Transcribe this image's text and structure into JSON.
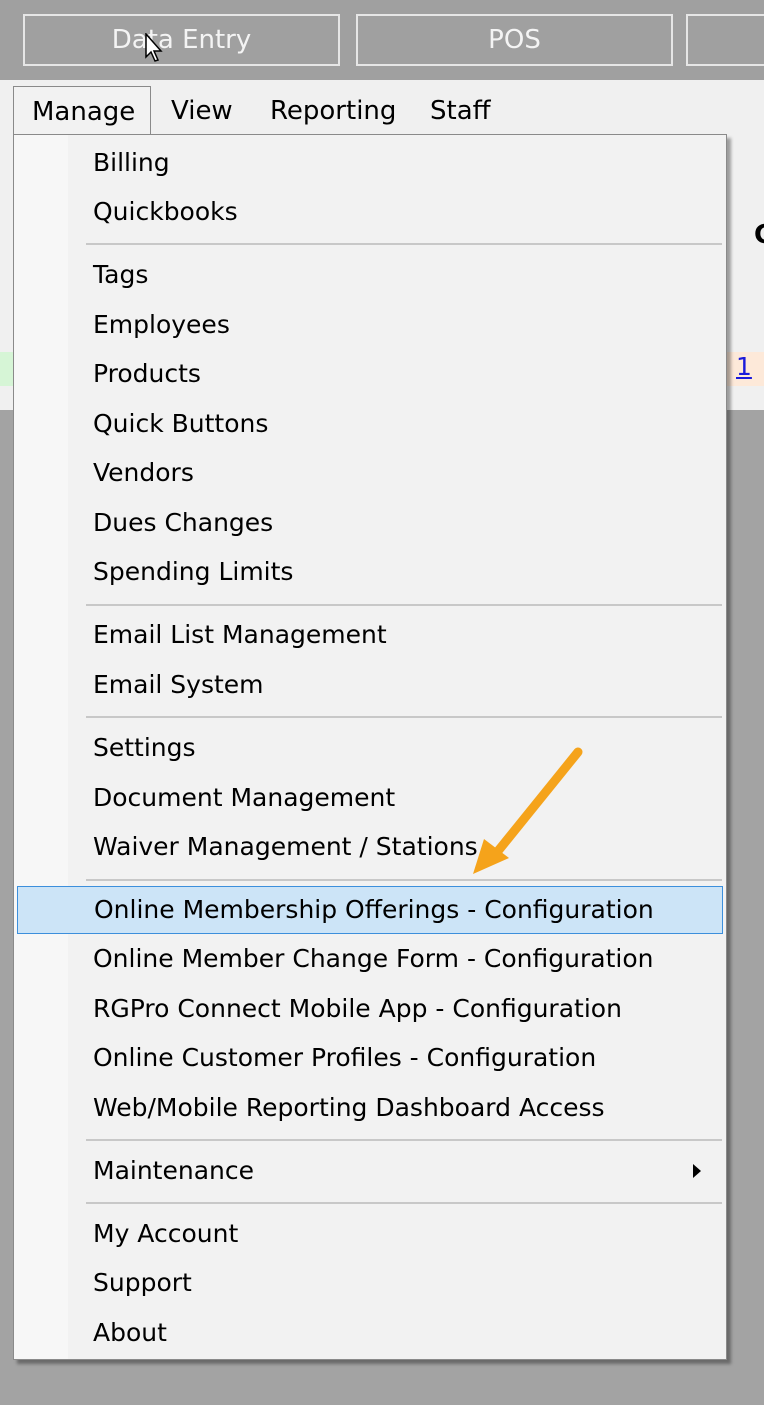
{
  "toolbar": {
    "buttons": [
      "Data Entry",
      "POS",
      ""
    ]
  },
  "menubar": {
    "items": [
      "Manage",
      "View",
      "Reporting",
      "Staff"
    ],
    "active": "Manage",
    "right_peek_char": "C",
    "link_peek": "1"
  },
  "manage_menu": {
    "groups": [
      [
        "Billing",
        "Quickbooks"
      ],
      [
        "Tags",
        "Employees",
        "Products",
        "Quick Buttons",
        "Vendors",
        "Dues Changes",
        "Spending Limits"
      ],
      [
        "Email List Management",
        "Email System"
      ],
      [
        "Settings",
        "Document Management",
        "Waiver Management / Stations"
      ],
      [
        "Online Membership Offerings - Configuration",
        "Online Member Change Form - Configuration",
        "RGPro Connect Mobile App - Configuration",
        "Online Customer Profiles - Configuration",
        "Web/Mobile Reporting Dashboard Access"
      ],
      [
        "Maintenance"
      ],
      [
        "My Account",
        "Support",
        "About"
      ]
    ],
    "highlighted": "Online Membership Offerings - Configuration",
    "has_submenu": "Maintenance"
  },
  "annotation": {
    "arrow_color": "#f5a31b",
    "highlight_bg": "#cce4f7",
    "highlight_border": "#3c8fdc"
  }
}
